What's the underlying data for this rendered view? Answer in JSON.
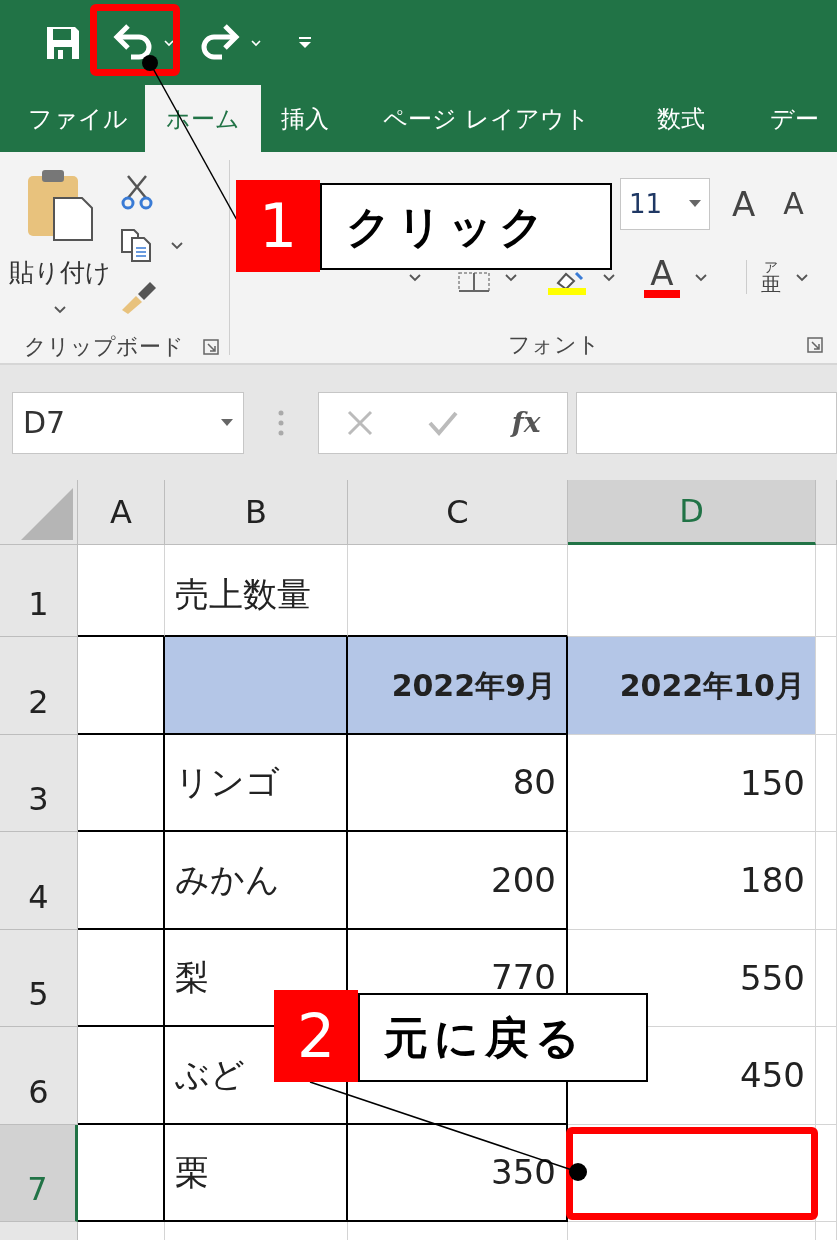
{
  "tabs": [
    {
      "label": "ファイル",
      "selected": false
    },
    {
      "label": "ホーム",
      "selected": true
    },
    {
      "label": "挿入",
      "selected": false
    },
    {
      "label": "ページ レイアウト",
      "selected": false
    },
    {
      "label": "数式",
      "selected": false
    },
    {
      "label": "デー",
      "selected": false
    }
  ],
  "ribbon": {
    "clipboard": {
      "paste_label": "貼り付け",
      "group_label": "クリップボード"
    },
    "font": {
      "font_size": "11",
      "grow_label": "A",
      "shrink_label": "A",
      "font_color_label": "A",
      "phonetic_top": "ア",
      "phonetic_label": "亜",
      "group_label": "フォント"
    }
  },
  "name_box": "D7",
  "function_label": "fx",
  "columns": [
    {
      "label": "A",
      "selected": false
    },
    {
      "label": "B",
      "selected": false
    },
    {
      "label": "C",
      "selected": false
    },
    {
      "label": "D",
      "selected": true
    }
  ],
  "rows": [
    {
      "header": "1",
      "selected": false,
      "kind": "title",
      "cells": {
        "B": "売上数量"
      }
    },
    {
      "header": "2",
      "selected": false,
      "kind": "header",
      "cells": {
        "C": "2022年9月",
        "D": "2022年10月"
      }
    },
    {
      "header": "3",
      "selected": false,
      "kind": "data",
      "cells": {
        "B": "リンゴ",
        "C": "80",
        "D": "150"
      }
    },
    {
      "header": "4",
      "selected": false,
      "kind": "data",
      "cells": {
        "B": "みかん",
        "C": "200",
        "D": "180"
      }
    },
    {
      "header": "5",
      "selected": false,
      "kind": "data",
      "cells": {
        "B": "梨",
        "C": "770",
        "D": "550"
      }
    },
    {
      "header": "6",
      "selected": false,
      "kind": "data",
      "cells": {
        "B": "ぶど",
        "D": "450"
      }
    },
    {
      "header": "7",
      "selected": true,
      "kind": "data",
      "cells": {
        "B": "栗",
        "C": "350"
      }
    }
  ],
  "callouts": [
    {
      "number": "1",
      "text": "クリック"
    },
    {
      "number": "2",
      "text": "元に戻る"
    }
  ]
}
